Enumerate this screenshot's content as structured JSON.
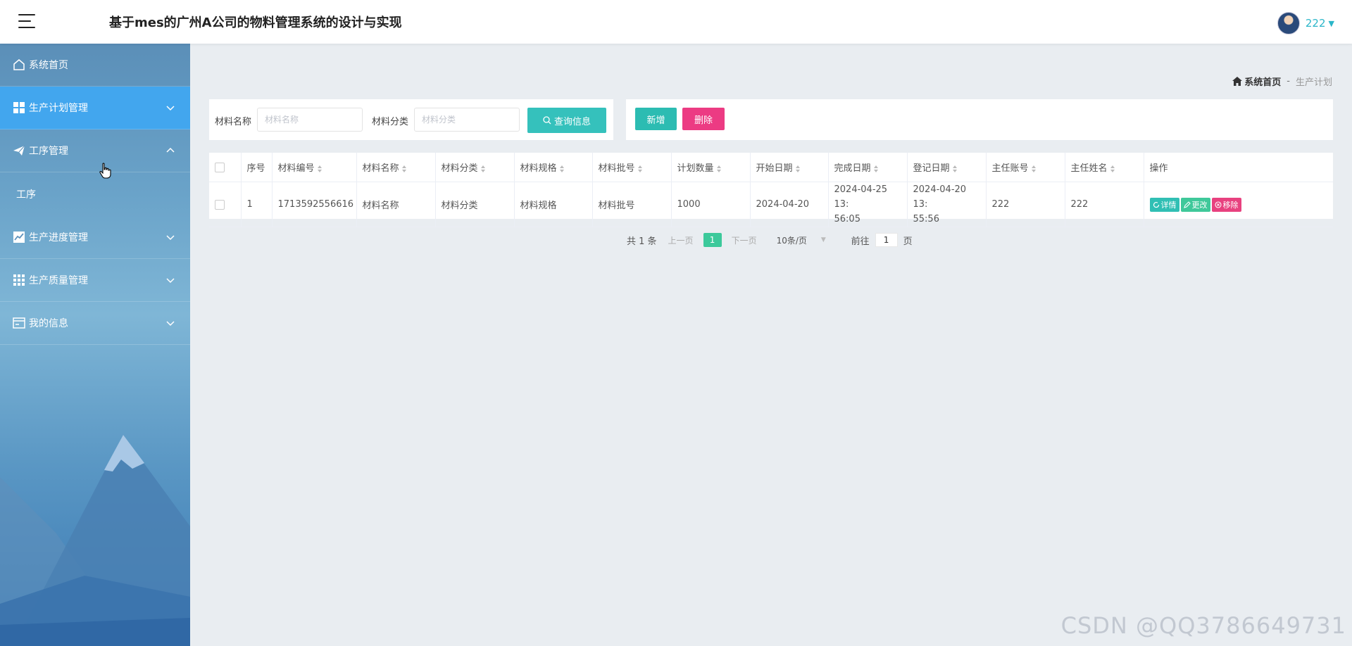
{
  "header": {
    "title": "基于mes的广州A公司的物料管理系统的设计与实现",
    "user_name": "222"
  },
  "sidebar": {
    "items": [
      {
        "label": "系统首页",
        "icon": "home-icon"
      },
      {
        "label": "生产计划管理",
        "icon": "grid-icon",
        "active": true
      },
      {
        "label": "工序管理",
        "icon": "paper-plane-icon",
        "expanded": true,
        "children": [
          {
            "label": "工序"
          }
        ]
      },
      {
        "label": "生产进度管理",
        "icon": "chart-icon"
      },
      {
        "label": "生产质量管理",
        "icon": "grid-icon"
      },
      {
        "label": "我的信息",
        "icon": "card-icon"
      }
    ]
  },
  "breadcrumb": {
    "home": "系统首页",
    "separator": "-",
    "current": "生产计划"
  },
  "search": {
    "name_label": "材料名称",
    "name_placeholder": "材料名称",
    "category_label": "材料分类",
    "category_placeholder": "材料分类",
    "query_button": "查询信息"
  },
  "actions": {
    "add": "新增",
    "delete": "删除"
  },
  "table": {
    "columns": [
      "序号",
      "材料编号",
      "材料名称",
      "材料分类",
      "材料规格",
      "材料批号",
      "计划数量",
      "开始日期",
      "完成日期",
      "登记日期",
      "主任账号",
      "主任姓名",
      "操作"
    ],
    "rows": [
      {
        "index": "1",
        "code": "1713592556616",
        "name": "材料名称",
        "category": "材料分类",
        "spec": "材料规格",
        "batch": "材料批号",
        "quantity": "1000",
        "start_date": "2024-04-20",
        "finish_date_line1": "2024-04-25 13:",
        "finish_date_line2": "56:05",
        "register_date_line1": "2024-04-20 13:",
        "register_date_line2": "55:56",
        "director_account": "222",
        "director_name": "222",
        "ops": {
          "detail": "详情",
          "edit": "更改",
          "remove": "移除"
        }
      }
    ]
  },
  "pagination": {
    "total": "共 1 条",
    "prev": "上一页",
    "current_page": "1",
    "next": "下一页",
    "page_size": "10条/页",
    "goto_label": "前往",
    "goto_value": "1",
    "page_suffix": "页"
  },
  "watermark": "CSDN @QQ3786649731",
  "colors": {
    "accent": "#35c1bc",
    "sidebar_active": "#42a6ee",
    "delete": "#ec3b83",
    "link": "#2bb6c9"
  }
}
